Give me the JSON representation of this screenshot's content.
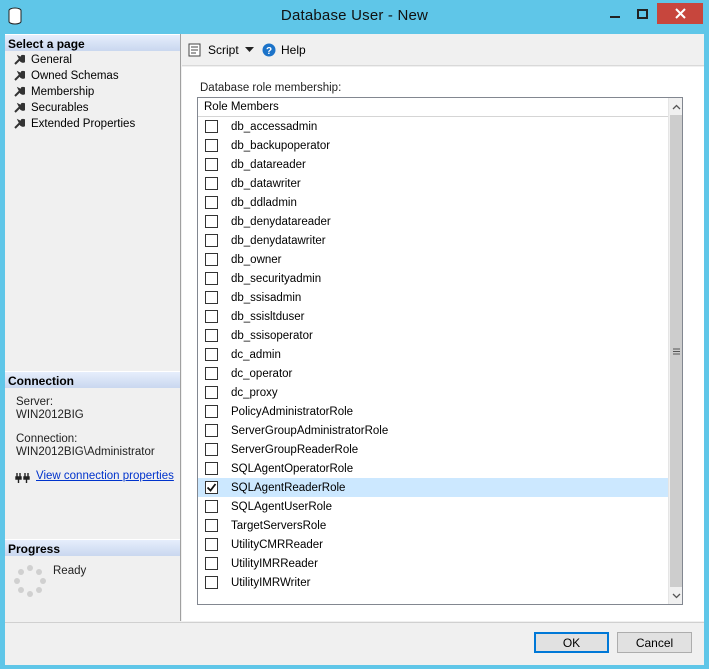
{
  "window": {
    "title": "Database User - New",
    "accent_color": "#5fc6e8",
    "close_color": "#c7463d"
  },
  "left": {
    "select_page_header": "Select a page",
    "pages": [
      {
        "label": "General",
        "icon": "wrench-icon"
      },
      {
        "label": "Owned Schemas",
        "icon": "wrench-icon"
      },
      {
        "label": "Membership",
        "icon": "wrench-icon"
      },
      {
        "label": "Securables",
        "icon": "wrench-icon"
      },
      {
        "label": "Extended Properties",
        "icon": "wrench-icon"
      }
    ],
    "connection_header": "Connection",
    "server_label": "Server:",
    "server_value": "WIN2012BIG",
    "connection_label": "Connection:",
    "connection_value": "WIN2012BIG\\Administrator",
    "view_props_link": "View connection properties",
    "progress_header": "Progress",
    "progress_status": "Ready"
  },
  "toolbar": {
    "script_label": "Script",
    "help_label": "Help"
  },
  "membership": {
    "section_label": "Database role membership:",
    "column_header": "Role Members",
    "roles": [
      {
        "name": "db_accessadmin",
        "checked": false
      },
      {
        "name": "db_backupoperator",
        "checked": false
      },
      {
        "name": "db_datareader",
        "checked": false
      },
      {
        "name": "db_datawriter",
        "checked": false
      },
      {
        "name": "db_ddladmin",
        "checked": false
      },
      {
        "name": "db_denydatareader",
        "checked": false
      },
      {
        "name": "db_denydatawriter",
        "checked": false
      },
      {
        "name": "db_owner",
        "checked": false
      },
      {
        "name": "db_securityadmin",
        "checked": false
      },
      {
        "name": "db_ssisadmin",
        "checked": false
      },
      {
        "name": "db_ssisltduser",
        "checked": false
      },
      {
        "name": "db_ssisoperator",
        "checked": false
      },
      {
        "name": "dc_admin",
        "checked": false
      },
      {
        "name": "dc_operator",
        "checked": false
      },
      {
        "name": "dc_proxy",
        "checked": false
      },
      {
        "name": "PolicyAdministratorRole",
        "checked": false
      },
      {
        "name": "ServerGroupAdministratorRole",
        "checked": false
      },
      {
        "name": "ServerGroupReaderRole",
        "checked": false
      },
      {
        "name": "SQLAgentOperatorRole",
        "checked": false
      },
      {
        "name": "SQLAgentReaderRole",
        "checked": true,
        "selected": true
      },
      {
        "name": "SQLAgentUserRole",
        "checked": false
      },
      {
        "name": "TargetServersRole",
        "checked": false
      },
      {
        "name": "UtilityCMRReader",
        "checked": false
      },
      {
        "name": "UtilityIMRReader",
        "checked": false
      },
      {
        "name": "UtilityIMRWriter",
        "checked": false
      }
    ]
  },
  "buttons": {
    "ok": "OK",
    "cancel": "Cancel"
  }
}
